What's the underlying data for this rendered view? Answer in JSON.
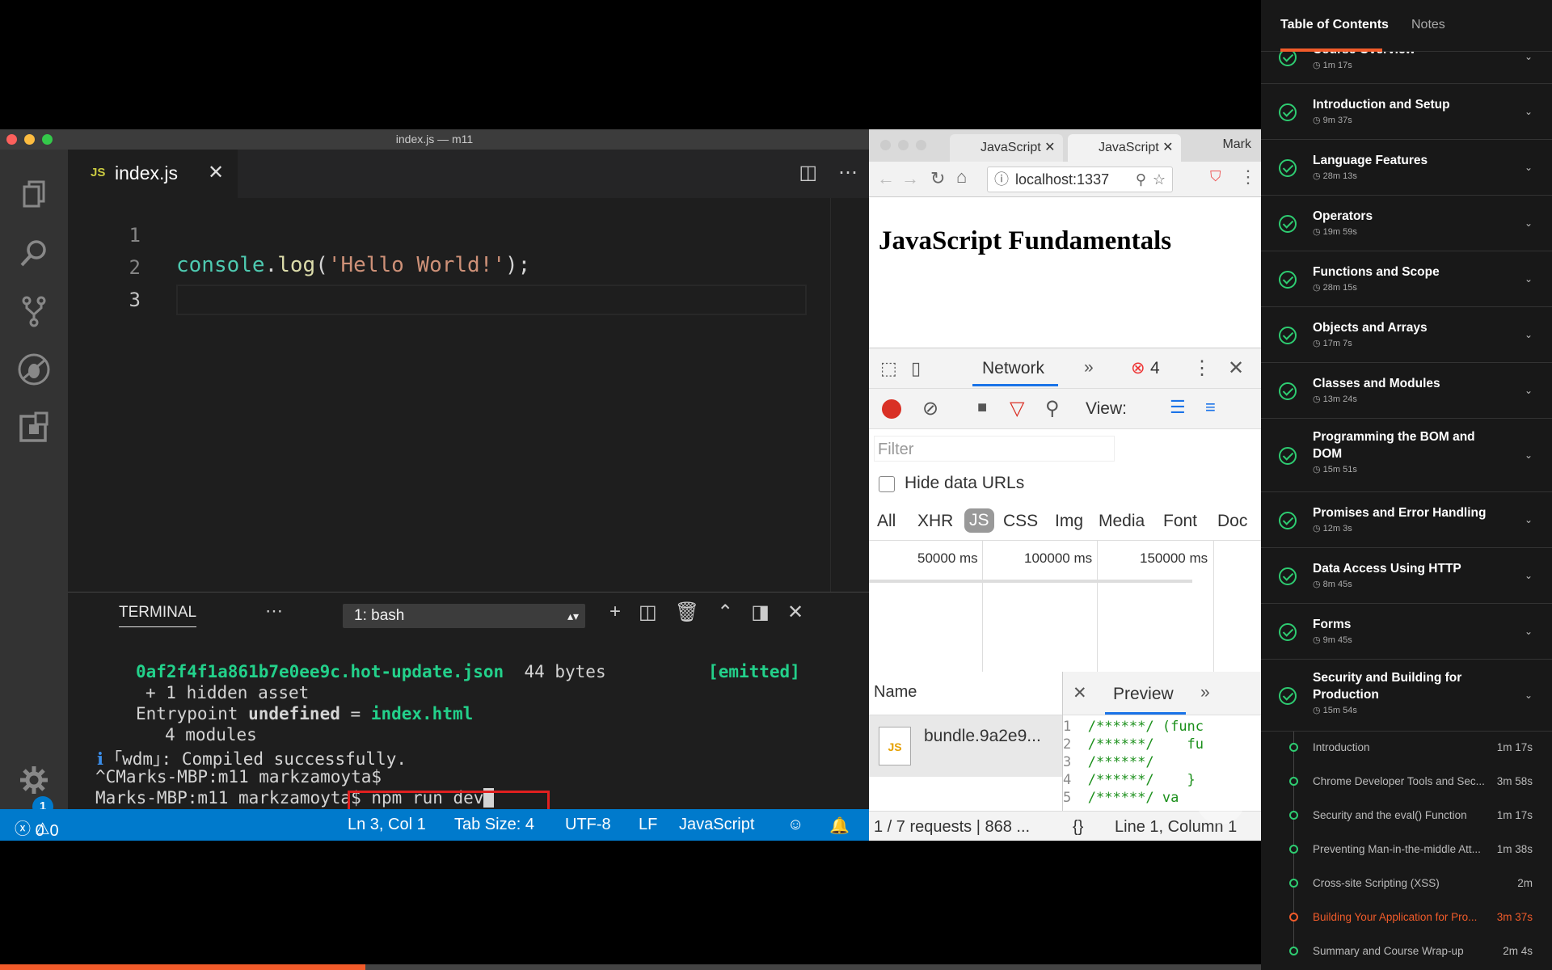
{
  "vscode": {
    "window_title": "index.js — m11",
    "tab": {
      "lang_badge": "JS",
      "filename": "index.js",
      "close": "✕"
    },
    "tab_actions": {
      "split": "◫",
      "more": "⋯"
    },
    "line_numbers": [
      "1",
      "2",
      "3"
    ],
    "code": {
      "fn": "console",
      "dot": ".",
      "method": "log",
      "open": "(",
      "str": "'Hello World!'",
      "close": ");"
    },
    "panel": {
      "title": "TERMINAL",
      "more": "⋯",
      "select_value": "1: bash",
      "select_arrow": "▴▾",
      "tools": [
        "+",
        "◫",
        "🗑",
        "⌃",
        "◨",
        "✕"
      ]
    },
    "terminal": {
      "file": "0af2f4f1a861b7e0ee9c.hot-update.json",
      "size": "44 bytes",
      "emitted": "[emitted]",
      "hidden": "+ 1 hidden asset",
      "entry_pre": "Entrypoint ",
      "entry_undef": "undefined",
      "entry_eq": " = ",
      "entry_file": "index.html",
      "modules": "4 modules",
      "wdm_i": "ℹ",
      "wdm": " ｢wdm｣: Compiled successfully.",
      "prompt1": "^CMarks-MBP:m11 markzamoyta$",
      "prompt2": "Marks-MBP:m11 markzamoyta$",
      "command": " npm run dev"
    },
    "status": {
      "errors": "0",
      "warnings": "0",
      "position": "Ln 3, Col 1",
      "tab_size": "Tab Size: 4",
      "encoding": "UTF-8",
      "eol": "LF",
      "language": "JavaScript"
    },
    "settings_badge": "1"
  },
  "chrome": {
    "tabs": [
      "JavaScript",
      "JavaScript"
    ],
    "profile": "Mark",
    "url": "localhost:1337",
    "heading": "JavaScript Fundamentals",
    "devtools": {
      "panel": "Network",
      "more": "»",
      "error_count": "4",
      "view_label": "View:",
      "filter_placeholder": "Filter",
      "hide_data_urls": "Hide data URLs",
      "types": [
        "All",
        "XHR",
        "JS",
        "CSS",
        "Img",
        "Media",
        "Font",
        "Doc"
      ],
      "timeline": [
        "50000 ms",
        "100000 ms",
        "150000 ms"
      ],
      "name_header": "Name",
      "preview_tab": "Preview",
      "request": "bundle.9a2e9...",
      "preview_lines": [
        {
          "n": "1",
          "code": "/******/ (func"
        },
        {
          "n": "2",
          "code": "/******/    fu"
        },
        {
          "n": "3",
          "code": "/******/"
        },
        {
          "n": "4",
          "code": "/******/    }"
        },
        {
          "n": "5",
          "code": "/******/ va"
        }
      ],
      "summary": "1 / 7 requests | 868 ...",
      "cursor": "Line 1, Column 1",
      "braces": "{}"
    }
  },
  "video_progress": 0.29,
  "sidebar": {
    "tabs": [
      "Table of Contents",
      "Notes"
    ],
    "modules": [
      {
        "title": "Course Overview",
        "duration": "1m 17s"
      },
      {
        "title": "Introduction and Setup",
        "duration": "9m 37s"
      },
      {
        "title": "Language Features",
        "duration": "28m 13s"
      },
      {
        "title": "Operators",
        "duration": "19m 59s"
      },
      {
        "title": "Functions and Scope",
        "duration": "28m 15s"
      },
      {
        "title": "Objects and Arrays",
        "duration": "17m 7s"
      },
      {
        "title": "Classes and Modules",
        "duration": "13m 24s"
      },
      {
        "title": "Programming the BOM and DOM",
        "duration": "15m 51s"
      },
      {
        "title": "Promises and Error Handling",
        "duration": "12m 3s"
      },
      {
        "title": "Data Access Using HTTP",
        "duration": "8m 45s"
      },
      {
        "title": "Forms",
        "duration": "9m 45s"
      },
      {
        "title": "Security and Building for Production",
        "duration": "15m 54s"
      }
    ],
    "clips": [
      {
        "title": "Introduction",
        "duration": "1m 17s"
      },
      {
        "title": "Chrome Developer Tools and Sec...",
        "duration": "3m 58s"
      },
      {
        "title": "Security and the eval() Function",
        "duration": "1m 17s"
      },
      {
        "title": "Preventing Man-in-the-middle Att...",
        "duration": "1m 38s"
      },
      {
        "title": "Cross-site Scripting (XSS)",
        "duration": "2m"
      },
      {
        "title": "Building Your Application for Pro...",
        "duration": "3m 37s"
      },
      {
        "title": "Summary and Course Wrap-up",
        "duration": "2m 4s"
      }
    ],
    "current_clip": 5,
    "colors": {
      "accent": "#f15b2a",
      "complete": "#2ecc71"
    }
  }
}
